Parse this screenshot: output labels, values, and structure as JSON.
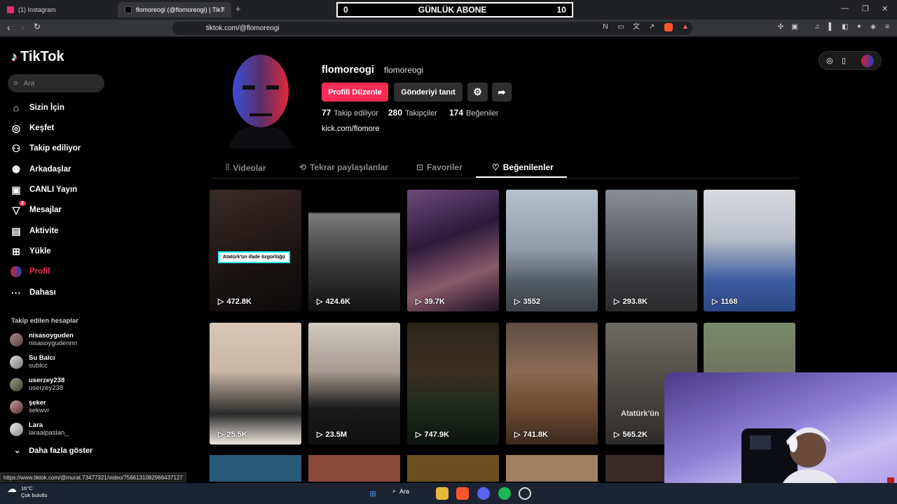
{
  "browser": {
    "tabs": [
      {
        "title": "(1) Instagram",
        "color": "#e1306c"
      },
      {
        "title": "flomoreogi (@flomoreogi) | TikT",
        "color": "#000000"
      }
    ],
    "url": "tiktok.com/@flomoreogi",
    "status_url": "https://www.tiktok.com/@murat.73477321/video/7566131082966437127"
  },
  "overlay": {
    "left": "0",
    "title": "GÜNLÜK ABONE",
    "right": "10"
  },
  "sidebar": {
    "logo": "TikTok",
    "search_placeholder": "Ara",
    "items": [
      {
        "label": "Sizin İçin",
        "icon": "home-icon"
      },
      {
        "label": "Keşfet",
        "icon": "compass-icon"
      },
      {
        "label": "Takip ediliyor",
        "icon": "following-icon"
      },
      {
        "label": "Arkadaşlar",
        "icon": "friends-icon"
      },
      {
        "label": "CANLI Yayın",
        "icon": "live-icon"
      },
      {
        "label": "Mesajlar",
        "icon": "messages-icon",
        "badge": "2"
      },
      {
        "label": "Aktivite",
        "icon": "activity-icon"
      },
      {
        "label": "Yükle",
        "icon": "upload-icon"
      },
      {
        "label": "Profil",
        "icon": "profile-icon"
      },
      {
        "label": "Dahası",
        "icon": "more-icon"
      }
    ],
    "following_title": "Takip edilen hesaplar",
    "following": [
      {
        "name": "nisasoyguden",
        "handle": "nisasoygudennn"
      },
      {
        "name": "Su Balcı",
        "handle": "sublcc"
      },
      {
        "name": "userzey238",
        "handle": "userzey238"
      },
      {
        "name": "şeker",
        "handle": "sekwvr"
      },
      {
        "name": "Lara",
        "handle": "laraalpaslan_"
      }
    ],
    "show_more": "Daha fazla göster"
  },
  "profile": {
    "username": "flomoreogi",
    "nickname": "flomoreogi",
    "edit_label": "Profili Düzenle",
    "promote_label": "Gönderiyi tanıt",
    "following_count": "77",
    "following_label": "Takip ediliyor",
    "followers_count": "280",
    "followers_label": "Takipçiler",
    "likes_count": "174",
    "likes_label": "Beğeniler",
    "link": "kick.com/flomore"
  },
  "tabs": [
    {
      "label": "Videolar"
    },
    {
      "label": "Tekrar paylaşılanlar"
    },
    {
      "label": "Favoriler"
    },
    {
      "label": "Beğenilenler",
      "active": true
    }
  ],
  "videos": [
    {
      "views": "472.8K",
      "caption": "Atatürk'ün ifade özgürlüğü",
      "bg": "linear-gradient(160deg,#3a2a28 0%,#1a1412 60%,#0c0a0a 100%)"
    },
    {
      "views": "424.6K",
      "bg": "linear-gradient(180deg,#000 0%,#000 18%,#7a7a7a 20%,#3a3a3a 60%,#111 100%)"
    },
    {
      "views": "39.7K",
      "bg": "linear-gradient(160deg,#6e4a7a 0%,#2b1a3a 40%,#8a5a6a 70%,#1a1020 100%)"
    },
    {
      "views": "3552",
      "bg": "linear-gradient(180deg,#b8c2cc 0%,#8f9ba8 50%,#555e66 75%,#3a3f44 100%)"
    },
    {
      "views": "293.8K",
      "bg": "linear-gradient(180deg,#8a8f96 0%,#5b5e63 45%,#3b3c40 70%,#2a2a2c 100%)"
    },
    {
      "views": "1168",
      "bg": "linear-gradient(180deg,#d8dadf 0%,#b9bec7 40%,#3c5ba0 75%,#2c4784 100%)"
    },
    {
      "views": "25.5K",
      "bg": "linear-gradient(180deg,#d8c8b8 0%,#c9b6a5 40%,#2b2b2b 75%,#f0e8e0 100%)"
    },
    {
      "views": "23.5M",
      "bg": "linear-gradient(180deg,#cfc9c2 0%,#a69b90 40%,#1a1a1a 70%,#111 100%)"
    },
    {
      "views": "747.9K",
      "bg": "linear-gradient(180deg,#2a2418 0%,#3a3020 40%,#1e2a1e 70%,#0e140e 100%)"
    },
    {
      "views": "741.8K",
      "bg": "linear-gradient(180deg,#5e4d43 0%,#8a6a55 40%,#6b4a30 70%,#3a2a20 100%)"
    },
    {
      "views": "565.2K",
      "caption2": "Atatürk'ün",
      "bg": "linear-gradient(180deg,#6f6a66 0%,#4e4a46 50%,#2e2c2a 100%)"
    },
    {
      "views": "",
      "bg": "linear-gradient(180deg,#7a8a6a 0%,#6a6a5a 60%,#5a4a3a 100%)"
    }
  ],
  "row3_colors": [
    "#2a5a7a",
    "#8a4a3a",
    "#6a5020",
    "#a08060",
    "#3a2a2a"
  ],
  "taskbar": {
    "temp": "16°C",
    "weather": "Çok bulutlu",
    "search": "Ara"
  }
}
